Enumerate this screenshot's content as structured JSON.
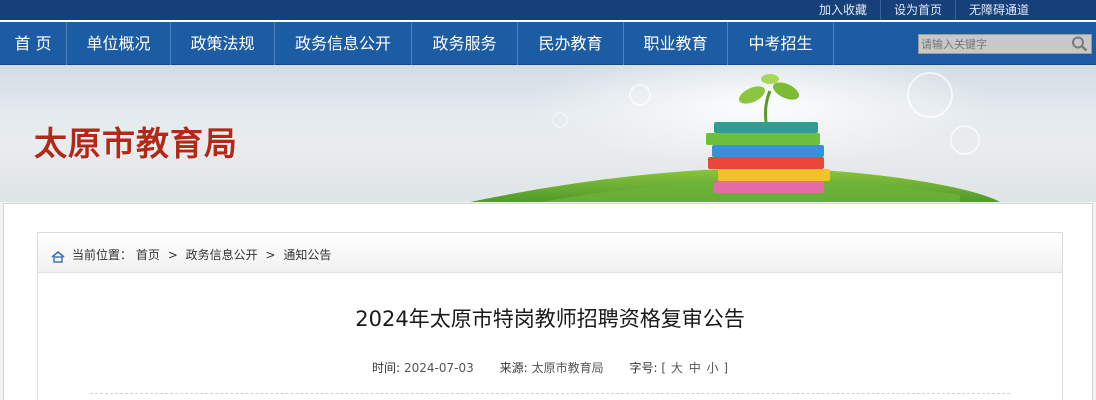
{
  "topbar": {
    "links": [
      "加入收藏",
      "设为首页",
      "无障碍通道"
    ]
  },
  "nav": {
    "items": [
      "首 页",
      "单位概况",
      "政策法规",
      "政务信息公开",
      "政务服务",
      "民办教育",
      "职业教育",
      "中考招生"
    ],
    "search_placeholder": "请输入关键字"
  },
  "banner": {
    "title": "太原市教育局"
  },
  "breadcrumb": {
    "prefix": "当前位置：",
    "items": [
      "首页",
      "政务信息公开",
      "通知公告"
    ],
    "separator": ">"
  },
  "article": {
    "title": "2024年太原市特岗教师招聘资格复审公告",
    "time_label": "时间:",
    "time": "2024-07-03",
    "source_label": "来源:",
    "source": "太原市教育局",
    "fontsize_label": "字号:",
    "fontsize_open": "[",
    "fontsize_options": [
      "大",
      "中",
      "小"
    ],
    "fontsize_close": "]"
  },
  "colors": {
    "nav_bg": "#1c5ca3",
    "topbar_bg": "#17407a",
    "title_red": "#b42818"
  }
}
